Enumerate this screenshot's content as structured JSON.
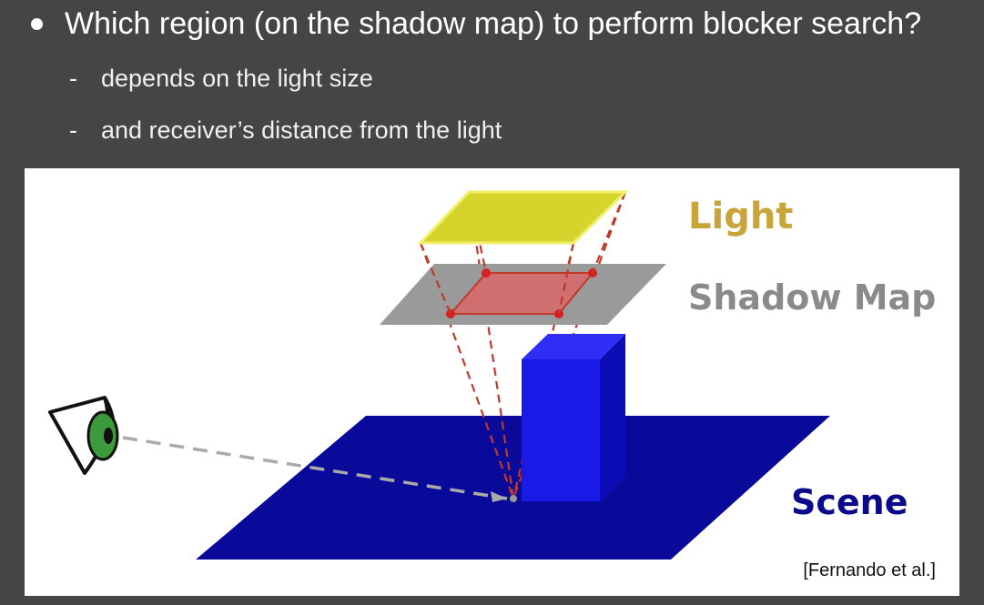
{
  "slide": {
    "bullet": "Which region (on the shadow map) to perform blocker search?",
    "subbullets": [
      {
        "dash": "-",
        "text": "depends on the light size"
      },
      {
        "dash": "-",
        "text": "and receiver’s distance from the light"
      }
    ]
  },
  "figure": {
    "labels": {
      "light": "Light",
      "shadow_map": "Shadow Map",
      "scene": "Scene"
    },
    "citation": "[Fernando et al.]",
    "colors": {
      "light_plane": "#d6d32d",
      "light_label": "#c9a43a",
      "shadow_map_plane": "#9a9a9a",
      "shadow_map_label": "#8a8a8a",
      "search_region": "#e06060",
      "frustum_lines": "#c0392b",
      "scene_plane": "#0a0a9a",
      "scene_label": "#0a0a8a",
      "blocker_box": "#1a1ae6",
      "view_ray": "#aaaaaa",
      "eye_iris": "#3c9a3c"
    },
    "icons": [
      "eye-icon"
    ]
  }
}
